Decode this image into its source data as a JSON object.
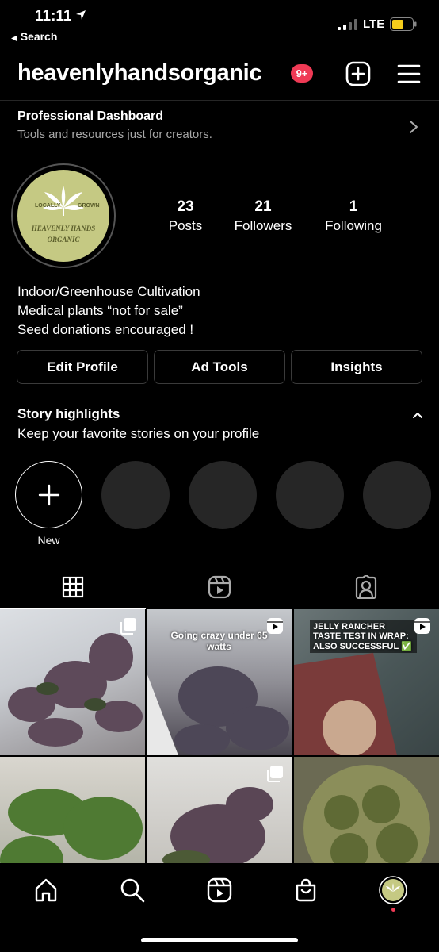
{
  "status_bar": {
    "time": "11:11",
    "back_label": "Search",
    "network": "LTE"
  },
  "header": {
    "username": "heavenlyhandsorganic",
    "notification_badge": "9+"
  },
  "dashboard": {
    "title": "Professional Dashboard",
    "subtitle": "Tools and resources just for creators."
  },
  "profile": {
    "avatar_text_top_left": "LOCALLY",
    "avatar_text_top_right": "GROWN",
    "avatar_text_line1": "HEAVENLY HANDS",
    "avatar_text_line2": "ORGANIC",
    "stats": [
      {
        "value": "23",
        "label": "Posts"
      },
      {
        "value": "21",
        "label": "Followers"
      },
      {
        "value": "1",
        "label": "Following"
      }
    ],
    "bio": [
      "Indoor/Greenhouse Cultivation",
      "Medical plants “not for sale”",
      "Seed donations encouraged !"
    ]
  },
  "actions": {
    "edit_profile": "Edit Profile",
    "ad_tools": "Ad Tools",
    "insights": "Insights"
  },
  "story_highlights": {
    "title": "Story highlights",
    "subtitle": "Keep your favorite stories on your profile",
    "new_label": "New"
  },
  "grid": {
    "captions": [
      "Going crazy under 65 watts",
      "JELLY RANCHER TASTE TEST IN WRAP: ALSO SUCCESSFUL ✅"
    ]
  },
  "colors": {
    "accent_badge": "#ef3a55",
    "background": "#000000",
    "highlight_placeholder": "#262626",
    "battery": "#f5cc1b"
  }
}
